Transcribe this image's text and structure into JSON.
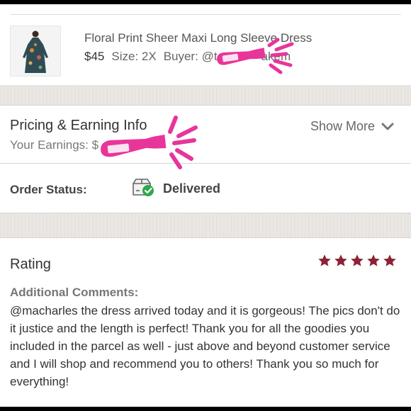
{
  "product": {
    "title": "Floral Print Sheer Maxi Long Sleeve Dress",
    "price": "$45",
    "size_label": "Size: 2X",
    "buyer_label": "Buyer:",
    "buyer_name": "@t",
    "buyer_name_tail": "akem",
    "thumbnail_icon": "dress-photo"
  },
  "pricing": {
    "title": "Pricing & Earning Info",
    "earnings_label": "Your Earnings:",
    "earnings_value": "$",
    "show_more": "Show More",
    "chevron_icon": "chevron-down-icon"
  },
  "order": {
    "status_label": "Order Status:",
    "status_value": "Delivered",
    "status_icon": "delivered-box-icon",
    "status_color": "#2ea84b"
  },
  "rating": {
    "title": "Rating",
    "stars": 5,
    "star_color": "#8b2335",
    "comments_label": "Additional Comments:",
    "comment": "@macharles the dress arrived today and it is gorgeous! The pics don't do it justice and the length is perfect! Thank you for all the goodies you included in the parcel as well - just above and beyond customer service and I will shop and recommend you to others! Thank you so much for everything!"
  },
  "colors": {
    "redaction": "#e8359a",
    "band": "#ebe7e3"
  }
}
